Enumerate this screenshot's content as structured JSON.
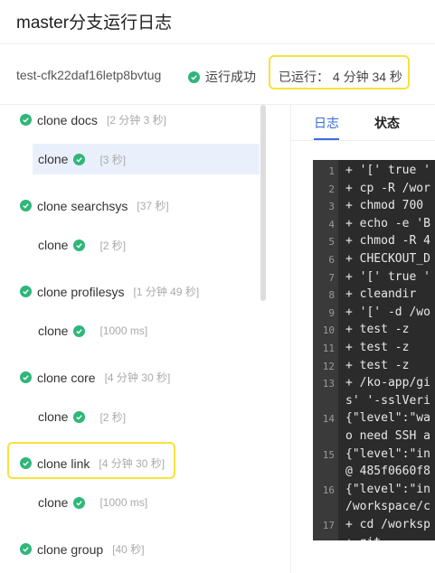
{
  "header": {
    "title": "master分支运行日志",
    "run_id": "test-cfk22daf16letp8bvtug",
    "status": "运行成功",
    "elapsed": "已运行： 4 分钟 34 秒"
  },
  "steps": [
    {
      "name": "clone docs",
      "duration": "[2 分钟 3 秒]",
      "sub": {
        "name": "clone",
        "duration": "[3 秒]",
        "active": true
      }
    },
    {
      "name": "clone searchsys",
      "duration": "[37 秒]",
      "sub": {
        "name": "clone",
        "duration": "[2 秒]"
      }
    },
    {
      "name": "clone profilesys",
      "duration": "[1 分钟 49 秒]",
      "sub": {
        "name": "clone",
        "duration": "[1000 ms]"
      }
    },
    {
      "name": "clone core",
      "duration": "[4 分钟 30 秒]",
      "sub": {
        "name": "clone",
        "duration": "[2 秒]"
      }
    },
    {
      "name": "clone link",
      "duration": "[4 分钟 30 秒]",
      "highlighted": true,
      "sub": {
        "name": "clone",
        "duration": "[1000 ms]"
      }
    },
    {
      "name": "clone group",
      "duration": "[40 秒]"
    }
  ],
  "tabs": {
    "log": "日志",
    "status": "状态"
  },
  "log_lines": [
    {
      "n": "1",
      "text": "+ '[' true '"
    },
    {
      "n": "2",
      "text": "+ cp -R /wor"
    },
    {
      "n": "3",
      "text": "+ chmod 700 "
    },
    {
      "n": "4",
      "text": "+ echo -e 'B"
    },
    {
      "n": "5",
      "text": "+ chmod -R 4"
    },
    {
      "n": "6",
      "text": "+ CHECKOUT_D"
    },
    {
      "n": "7",
      "text": "+ '[' true '"
    },
    {
      "n": "8",
      "text": "+ cleandir"
    },
    {
      "n": "9",
      "text": "+ '[' -d /wo"
    },
    {
      "n": "10",
      "text": "+ test -z"
    },
    {
      "n": "11",
      "text": "+ test -z"
    },
    {
      "n": "12",
      "text": "+ test -z"
    },
    {
      "n": "13",
      "text": "+ /ko-app/gi"
    },
    {
      "n": "",
      "text": "s' '-sslVeri"
    },
    {
      "n": "14",
      "text": "{\"level\":\"wa"
    },
    {
      "n": "",
      "text": "o need SSH a"
    },
    {
      "n": "15",
      "text": "{\"level\":\"in"
    },
    {
      "n": "",
      "text": "@ 485f0660f8"
    },
    {
      "n": "16",
      "text": "{\"level\":\"in"
    },
    {
      "n": "",
      "text": "/workspace/c"
    },
    {
      "n": "17",
      "text": "+ cd /worksp"
    },
    {
      "n": "",
      "text": "+ git"
    }
  ]
}
